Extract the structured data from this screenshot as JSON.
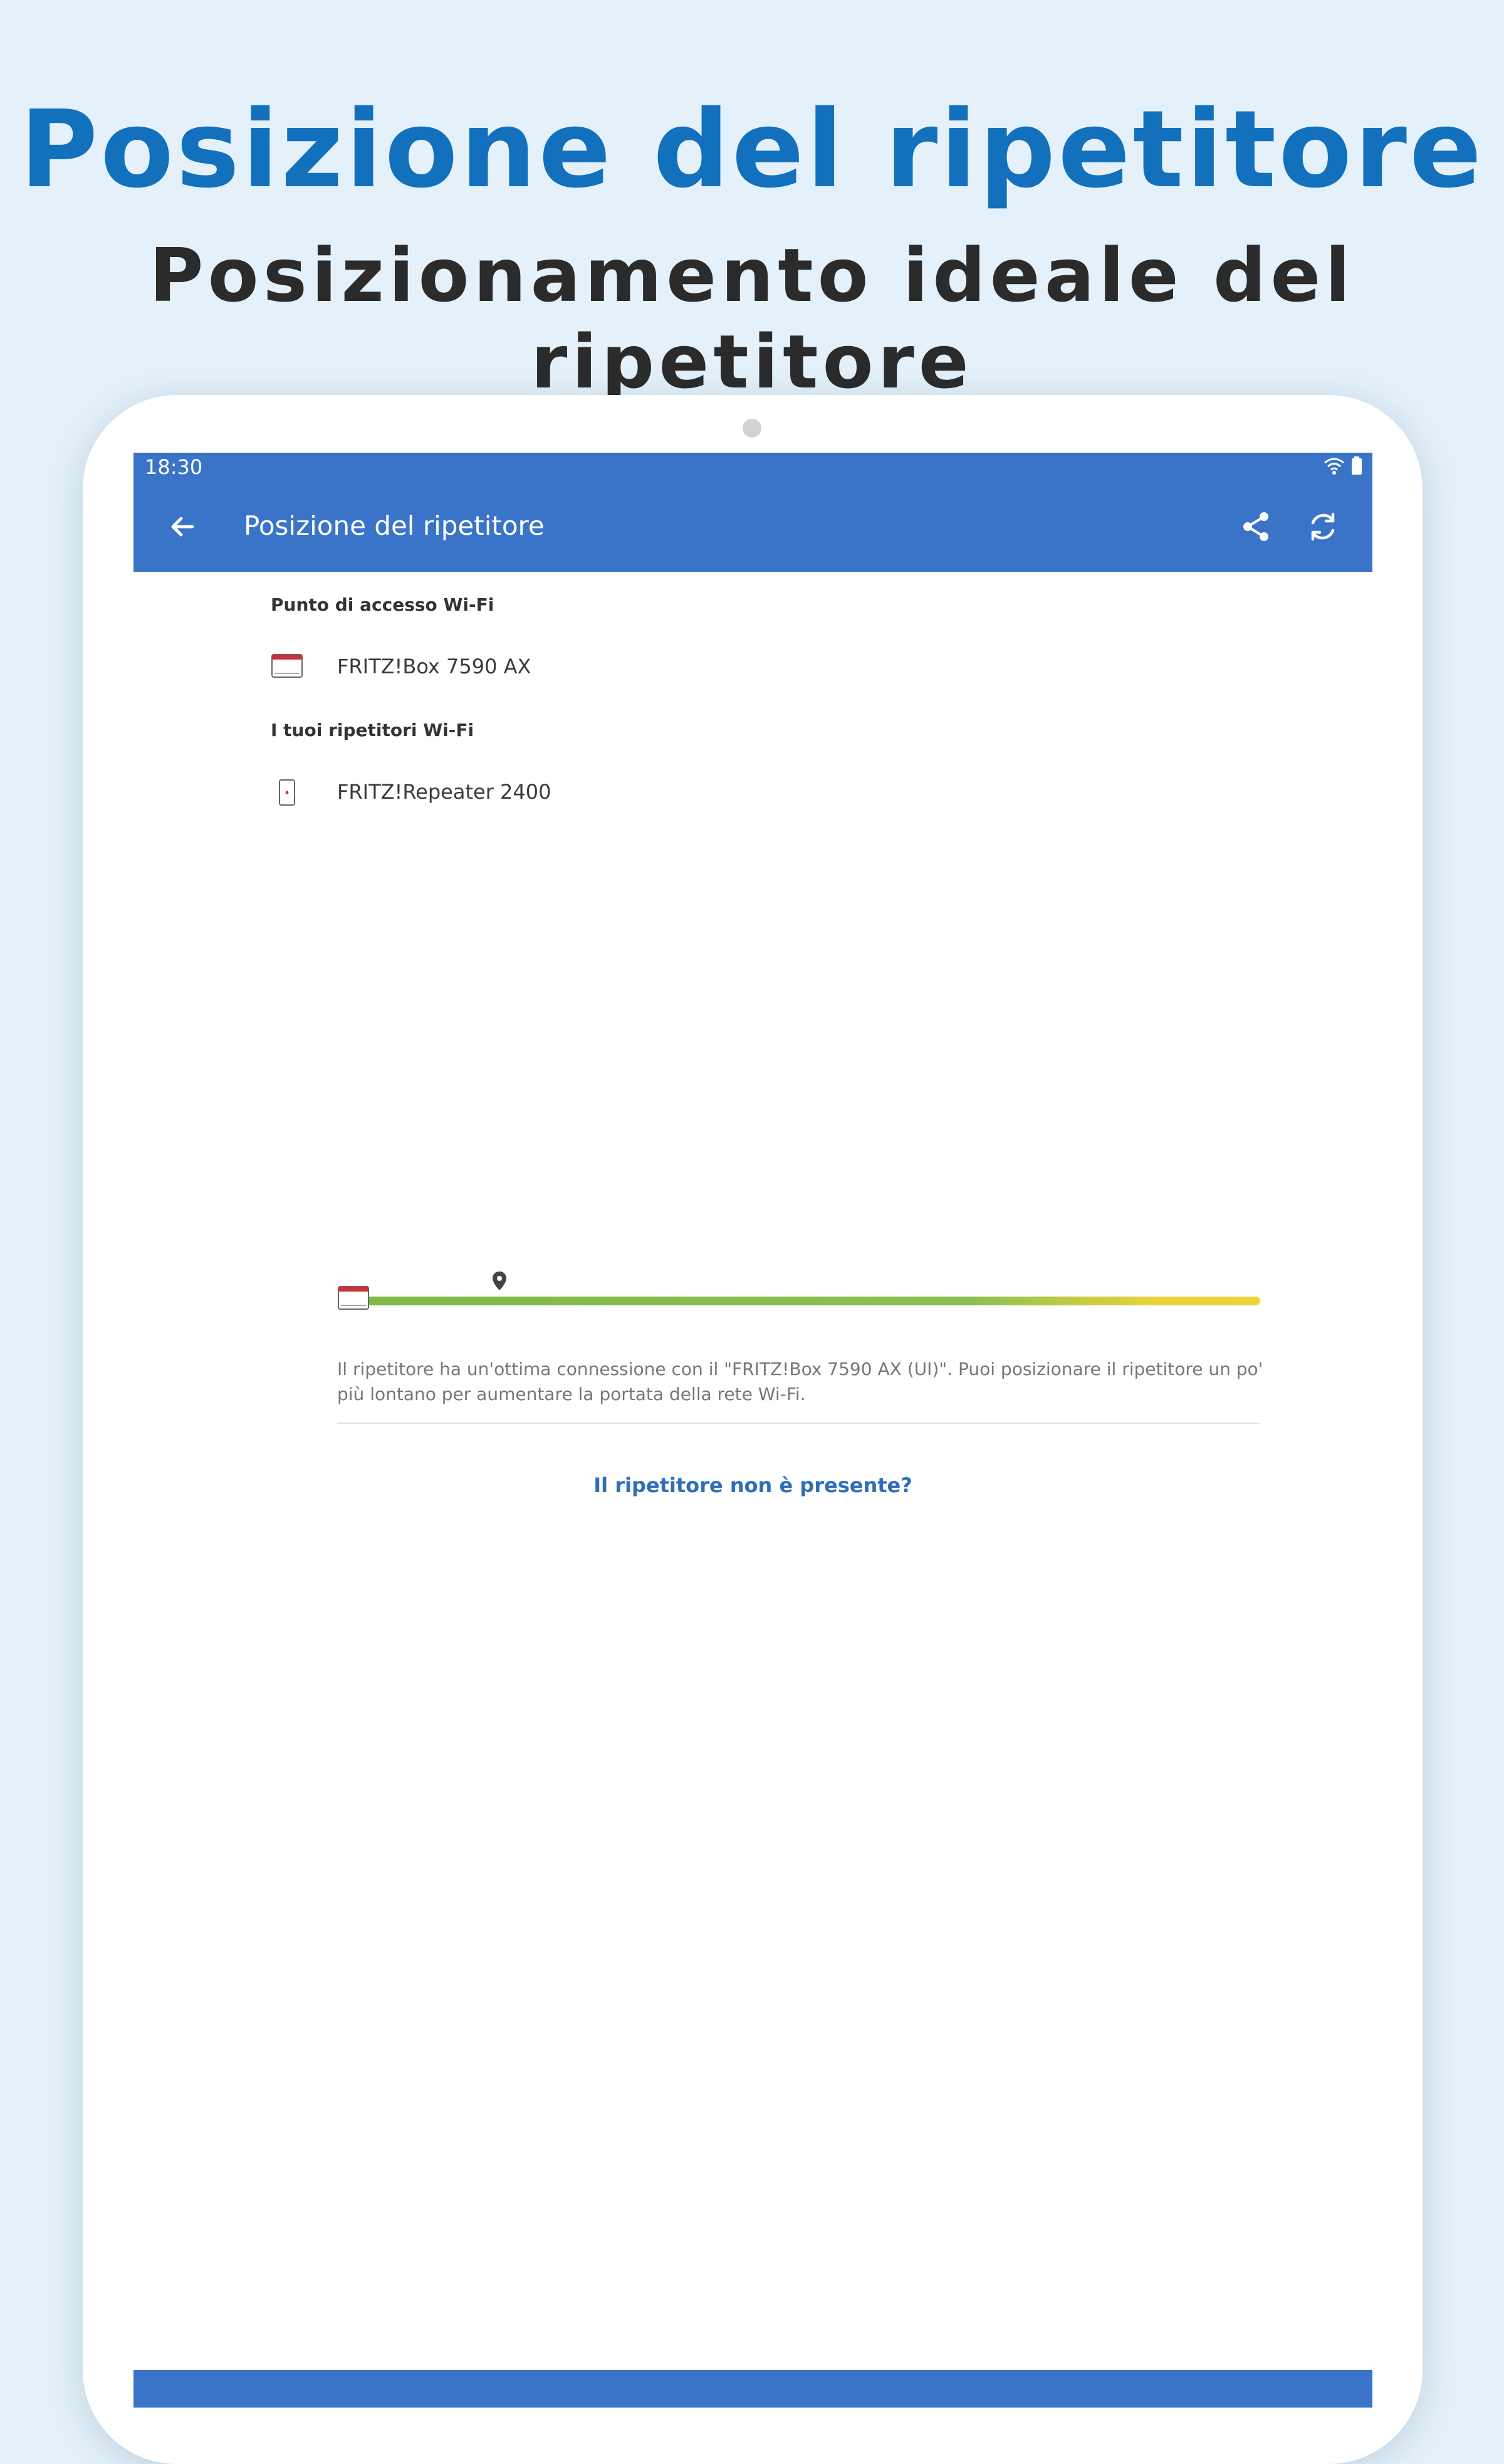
{
  "hero": {
    "title": "Posizione del ripetitore",
    "subtitle": "Posizionamento ideale del ripetitore"
  },
  "statusbar": {
    "time": "18:30",
    "icons": [
      "wifi-icon",
      "battery-icon"
    ]
  },
  "appbar": {
    "title": "Posizione del ripetitore",
    "icons": [
      "arrow-back-icon",
      "share-icon",
      "refresh-icon"
    ]
  },
  "access_point": {
    "section_label": "Punto di accesso Wi-Fi",
    "device_name": "FRITZ!Box 7590 AX",
    "icon": "router-icon"
  },
  "repeaters": {
    "section_label": "I tuoi ripetitori Wi-Fi",
    "items": [
      {
        "name": "FRITZ!Repeater 2400",
        "icon": "repeater-icon",
        "signal_position_fraction": 0.15,
        "description": "Il ripetitore ha un'ottima connessione con il \"FRITZ!Box 7590 AX (UI)\". Puoi posizionare il ripetitore un po' più lontano per aumentare la portata della rete Wi-Fi."
      }
    ]
  },
  "link_missing_repeater": "Il ripetitore non è presente?",
  "colors": {
    "hero_title": "#1270bd",
    "appbar": "#3a74c8",
    "link": "#2f6fb8",
    "signal_good": "#8dc050",
    "signal_fair": "#efd33b",
    "router_accent": "#c8323c"
  }
}
